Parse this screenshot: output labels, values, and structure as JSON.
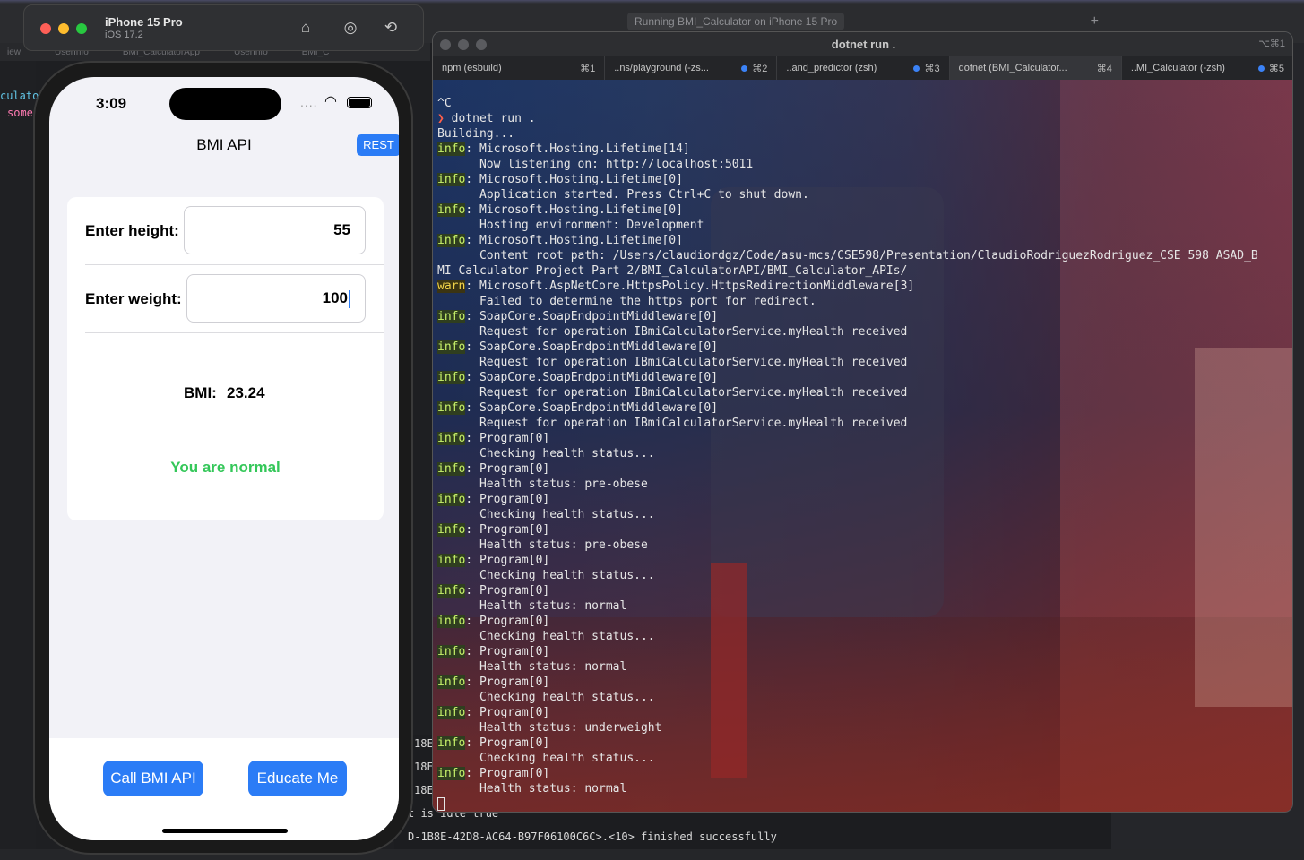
{
  "xcode": {
    "title_pill": "Running BMI_Calculator on iPhone 15 Pro",
    "plus": "+",
    "tabs": [
      "iew",
      "UserInfo",
      "BMI_CalculatorApp",
      "UserInfo",
      "BMI_C"
    ],
    "code_line1": "culato",
    "code_line2": "some",
    "console_lines": [
      "18E-",
      "18E-",
      "18E-",
      "t is idle true",
      "D-1B8E-42D8-AC64-B97F06100C6C>.<10> finished successfully"
    ]
  },
  "simulator": {
    "device_name": "iPhone 15 Pro",
    "os_version": "iOS 17.2",
    "home_icon": "⌂",
    "screenshot_icon": "◎",
    "rotate_icon": "⟲"
  },
  "phone": {
    "time": "3:09",
    "signal": "....",
    "wifi": "◠",
    "nav_title": "BMI API",
    "rest_button": "REST",
    "height_label": "Enter height:",
    "height_value": "55",
    "weight_label": "Enter weight:",
    "weight_value": "100",
    "bmi_label": "BMI:",
    "bmi_value": "23.24",
    "status_text": "You are normal",
    "call_button": "Call BMI API",
    "educate_button": "Educate Me",
    "colors": {
      "accent": "#2b7cf6",
      "status": "#34c759"
    }
  },
  "terminal": {
    "title": "dotnet run .",
    "shortcut": "⌥⌘1",
    "tabs": [
      {
        "label": "npm (esbuild)",
        "key": "⌘1",
        "dot": false,
        "active": false
      },
      {
        "label": "..ns/playground (-zs...",
        "key": "⌘2",
        "dot": true,
        "active": false
      },
      {
        "label": "..and_predictor (zsh)",
        "key": "⌘3",
        "dot": true,
        "active": false
      },
      {
        "label": "dotnet (BMI_Calculator...",
        "key": "⌘4",
        "dot": false,
        "active": true
      },
      {
        "label": "..MI_Calculator (-zsh)",
        "key": "⌘5",
        "dot": true,
        "active": false
      }
    ],
    "lines": [
      {
        "tag": "",
        "text": "^C"
      },
      {
        "tag": "prompt",
        "text": " dotnet run ."
      },
      {
        "tag": "",
        "text": "Building..."
      },
      {
        "tag": "info",
        "text": ": Microsoft.Hosting.Lifetime[14]"
      },
      {
        "tag": "",
        "text": "      Now listening on: http://localhost:5011"
      },
      {
        "tag": "info",
        "text": ": Microsoft.Hosting.Lifetime[0]"
      },
      {
        "tag": "",
        "text": "      Application started. Press Ctrl+C to shut down."
      },
      {
        "tag": "info",
        "text": ": Microsoft.Hosting.Lifetime[0]"
      },
      {
        "tag": "",
        "text": "      Hosting environment: Development"
      },
      {
        "tag": "info",
        "text": ": Microsoft.Hosting.Lifetime[0]"
      },
      {
        "tag": "",
        "text": "      Content root path: /Users/claudiordgz/Code/asu-mcs/CSE598/Presentation/ClaudioRodriguezRodriguez_CSE 598 ASAD_B"
      },
      {
        "tag": "",
        "text": "MI Calculator Project Part 2/BMI_CalculatorAPI/BMI_Calculator_APIs/"
      },
      {
        "tag": "warn",
        "text": ": Microsoft.AspNetCore.HttpsPolicy.HttpsRedirectionMiddleware[3]"
      },
      {
        "tag": "",
        "text": "      Failed to determine the https port for redirect."
      },
      {
        "tag": "info",
        "text": ": SoapCore.SoapEndpointMiddleware[0]"
      },
      {
        "tag": "",
        "text": "      Request for operation IBmiCalculatorService.myHealth received"
      },
      {
        "tag": "info",
        "text": ": SoapCore.SoapEndpointMiddleware[0]"
      },
      {
        "tag": "",
        "text": "      Request for operation IBmiCalculatorService.myHealth received"
      },
      {
        "tag": "info",
        "text": ": SoapCore.SoapEndpointMiddleware[0]"
      },
      {
        "tag": "",
        "text": "      Request for operation IBmiCalculatorService.myHealth received"
      },
      {
        "tag": "info",
        "text": ": SoapCore.SoapEndpointMiddleware[0]"
      },
      {
        "tag": "",
        "text": "      Request for operation IBmiCalculatorService.myHealth received"
      },
      {
        "tag": "info",
        "text": ": Program[0]"
      },
      {
        "tag": "",
        "text": "      Checking health status..."
      },
      {
        "tag": "info",
        "text": ": Program[0]"
      },
      {
        "tag": "",
        "text": "      Health status: pre-obese"
      },
      {
        "tag": "info",
        "text": ": Program[0]"
      },
      {
        "tag": "",
        "text": "      Checking health status..."
      },
      {
        "tag": "info",
        "text": ": Program[0]"
      },
      {
        "tag": "",
        "text": "      Health status: pre-obese"
      },
      {
        "tag": "info",
        "text": ": Program[0]"
      },
      {
        "tag": "",
        "text": "      Checking health status..."
      },
      {
        "tag": "info",
        "text": ": Program[0]"
      },
      {
        "tag": "",
        "text": "      Health status: normal"
      },
      {
        "tag": "info",
        "text": ": Program[0]"
      },
      {
        "tag": "",
        "text": "      Checking health status..."
      },
      {
        "tag": "info",
        "text": ": Program[0]"
      },
      {
        "tag": "",
        "text": "      Health status: normal"
      },
      {
        "tag": "info",
        "text": ": Program[0]"
      },
      {
        "tag": "",
        "text": "      Checking health status..."
      },
      {
        "tag": "info",
        "text": ": Program[0]"
      },
      {
        "tag": "",
        "text": "      Health status: underweight"
      },
      {
        "tag": "info",
        "text": ": Program[0]"
      },
      {
        "tag": "",
        "text": "      Checking health status..."
      },
      {
        "tag": "info",
        "text": ": Program[0]"
      },
      {
        "tag": "",
        "text": "      Health status: normal"
      },
      {
        "tag": "cursor",
        "text": ""
      }
    ]
  }
}
